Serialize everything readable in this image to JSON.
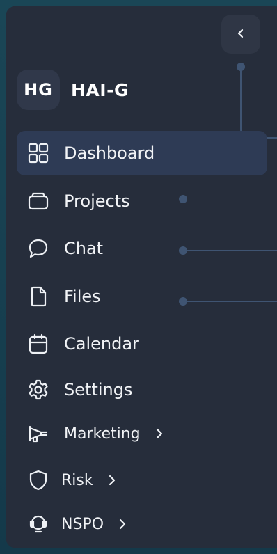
{
  "brand": {
    "initials": "HG",
    "name": "HAI-G"
  },
  "collapse_button": {
    "icon": "chevron-left-icon"
  },
  "nav": {
    "items": [
      {
        "label": "Dashboard",
        "icon": "dashboard-icon",
        "active": true
      },
      {
        "label": "Projects",
        "icon": "folder-icon"
      },
      {
        "label": "Chat",
        "icon": "chat-bubble-icon"
      },
      {
        "label": "Files",
        "icon": "file-icon"
      },
      {
        "label": "Calendar",
        "icon": "calendar-icon"
      },
      {
        "label": "Settings",
        "icon": "gear-icon"
      },
      {
        "label": "Marketing",
        "icon": "megaphone-icon",
        "has_submenu": true
      },
      {
        "label": "Risk",
        "icon": "shield-icon",
        "has_submenu": true
      },
      {
        "label": "NSPO",
        "icon": "headset-icon",
        "has_submenu": true
      }
    ]
  },
  "colors": {
    "sidebar_bg": "#262d3b",
    "active_bg": "#2e3b55",
    "accent_line": "#3f5472",
    "text": "#f1f3f6"
  }
}
